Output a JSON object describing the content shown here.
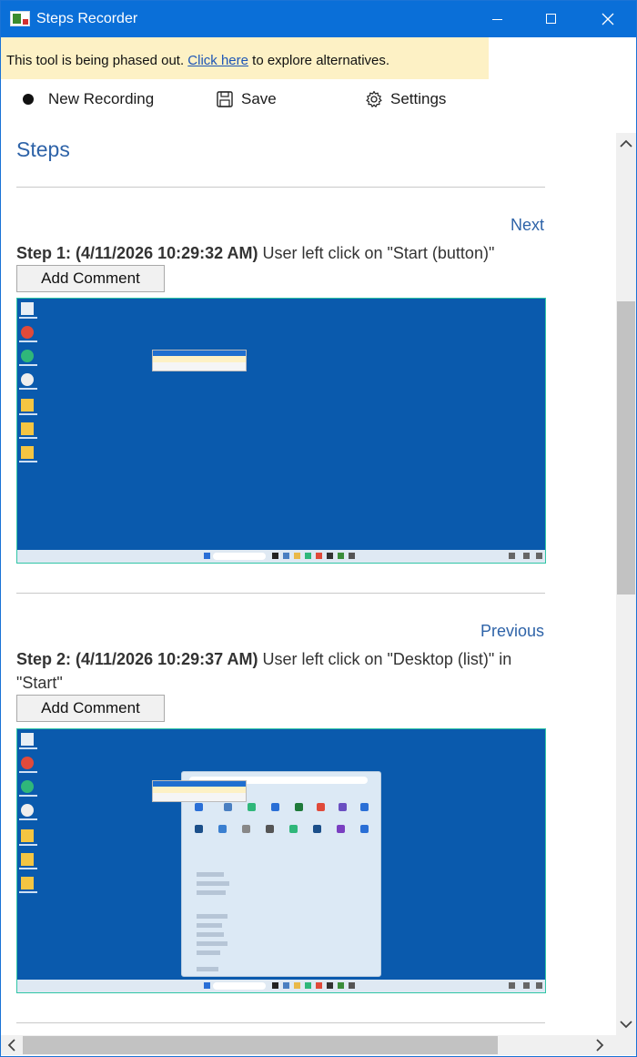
{
  "window": {
    "title": "Steps Recorder",
    "controls": {
      "minimize": "minimize",
      "maximize": "maximize",
      "close": "close"
    }
  },
  "banner": {
    "before": "This tool is being phased out. ",
    "link": "Click here",
    "after": " to explore alternatives."
  },
  "toolbar": {
    "new_recording": "New Recording",
    "save": "Save",
    "settings": "Settings"
  },
  "main": {
    "heading": "Steps",
    "steps": [
      {
        "nav": "Next",
        "header": "Step 1: (4/11/2026 10:29:32 AM)",
        "description": " User left click on \"Start (button)\"",
        "add_comment": "Add Comment"
      },
      {
        "nav": "Previous",
        "header": "Step 2: (4/11/2026 10:29:37 AM)",
        "description": " User left click on \"Desktop (list)\" in \"Start\"",
        "add_comment": "Add Comment"
      }
    ]
  },
  "icons": {
    "record": "record-dot-icon",
    "save": "floppy-disk-icon",
    "settings": "gear-icon"
  },
  "colors": {
    "titlebar": "#0a6fd8",
    "banner": "#fdf1c5",
    "heading": "#2e63a8",
    "desktop": "#0a5aad",
    "screenshot_border": "#30c5a6"
  }
}
